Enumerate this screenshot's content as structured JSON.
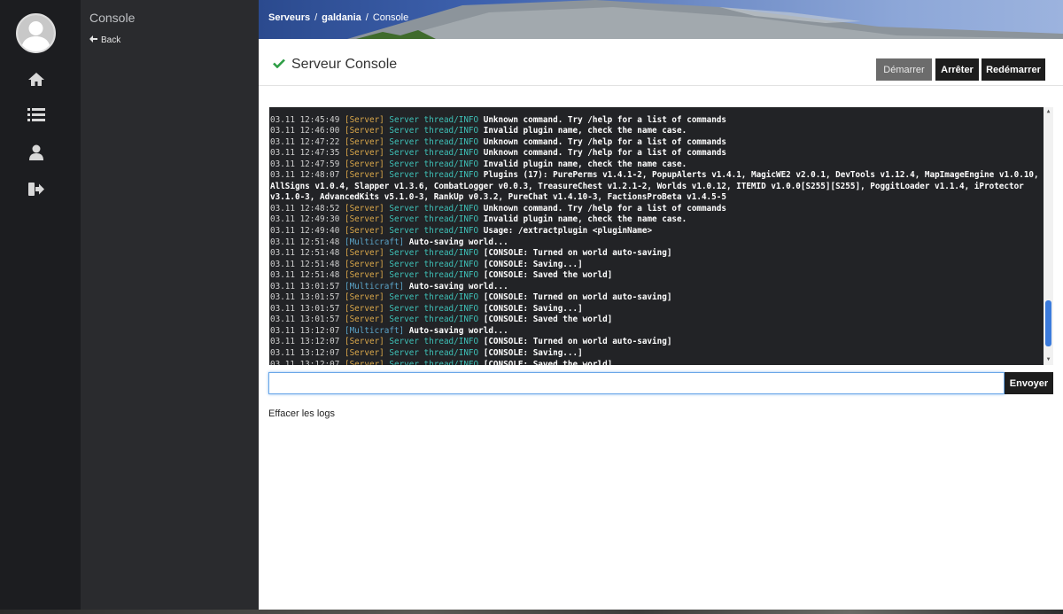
{
  "sidebar": {
    "icons": [
      "home-icon",
      "list-icon",
      "user-icon",
      "sign-out-icon"
    ]
  },
  "submenu": {
    "title": "Console",
    "back_label": "Back"
  },
  "breadcrumb": {
    "items": [
      "Serveurs",
      "galdania",
      "Console"
    ],
    "separator": "/"
  },
  "page": {
    "title": "Serveur Console",
    "status_icon": "check-icon",
    "status_color": "#2e9e45"
  },
  "buttons": {
    "start": "Démarrer",
    "stop": "Arrêter",
    "restart": "Redémarrer",
    "send": "Envoyer",
    "clear_logs": "Effacer les logs"
  },
  "command_input": {
    "value": "",
    "placeholder": ""
  },
  "colors": {
    "console_bg": "#222326",
    "server_tag": "#d9a74a",
    "multicraft_tag": "#5ba3c7",
    "thread": "#3ec0b7",
    "scroll_thumb": "#3b7bdc"
  },
  "console_lines": [
    {
      "ts": "",
      "src": "",
      "thread": "",
      "msg": ""
    },
    {
      "ts": "03.11 12:45:49",
      "src": "[Server]",
      "thread": "Server thread/INFO",
      "msg": "Unknown command. Try /help for a list of commands"
    },
    {
      "ts": "03.11 12:46:00",
      "src": "[Server]",
      "thread": "Server thread/INFO",
      "msg": "Invalid plugin name, check the name case."
    },
    {
      "ts": "03.11 12:47:22",
      "src": "[Server]",
      "thread": "Server thread/INFO",
      "msg": "Unknown command. Try /help for a list of commands"
    },
    {
      "ts": "03.11 12:47:35",
      "src": "[Server]",
      "thread": "Server thread/INFO",
      "msg": "Unknown command. Try /help for a list of commands"
    },
    {
      "ts": "03.11 12:47:59",
      "src": "[Server]",
      "thread": "Server thread/INFO",
      "msg": "Invalid plugin name, check the name case."
    },
    {
      "ts": "03.11 12:48:07",
      "src": "[Server]",
      "thread": "Server thread/INFO",
      "msg": "Plugins (17): PurePerms v1.4.1-2, PopupAlerts v1.4.1, MagicWE2 v2.0.1, DevTools v1.12.4, MapImageEngine v1.0.10, AllSigns v1.0.4, Slapper v1.3.6, CombatLogger v0.0.3, TreasureChest v1.2.1-2, Worlds v1.0.12, ITEMID v1.0.0[S255][S255], PoggitLoader v1.1.4, iProtector v3.1.0-3, AdvancedKits v5.1.0-3, RankUp v0.3.2, PureChat v1.4.10-3, FactionsProBeta v1.4.5-5"
    },
    {
      "ts": "03.11 12:48:52",
      "src": "[Server]",
      "thread": "Server thread/INFO",
      "msg": "Unknown command. Try /help for a list of commands"
    },
    {
      "ts": "03.11 12:49:30",
      "src": "[Server]",
      "thread": "Server thread/INFO",
      "msg": "Invalid plugin name, check the name case."
    },
    {
      "ts": "03.11 12:49:40",
      "src": "[Server]",
      "thread": "Server thread/INFO",
      "msg": "Usage: /extractplugin <pluginName>"
    },
    {
      "ts": "03.11 12:51:48",
      "src": "[Multicraft]",
      "thread": "",
      "msg": "Auto-saving world..."
    },
    {
      "ts": "03.11 12:51:48",
      "src": "[Server]",
      "thread": "Server thread/INFO",
      "msg": "[CONSOLE: Turned on world auto-saving]"
    },
    {
      "ts": "03.11 12:51:48",
      "src": "[Server]",
      "thread": "Server thread/INFO",
      "msg": "[CONSOLE: Saving...]"
    },
    {
      "ts": "03.11 12:51:48",
      "src": "[Server]",
      "thread": "Server thread/INFO",
      "msg": "[CONSOLE: Saved the world]"
    },
    {
      "ts": "03.11 13:01:57",
      "src": "[Multicraft]",
      "thread": "",
      "msg": "Auto-saving world..."
    },
    {
      "ts": "03.11 13:01:57",
      "src": "[Server]",
      "thread": "Server thread/INFO",
      "msg": "[CONSOLE: Turned on world auto-saving]"
    },
    {
      "ts": "03.11 13:01:57",
      "src": "[Server]",
      "thread": "Server thread/INFO",
      "msg": "[CONSOLE: Saving...]"
    },
    {
      "ts": "03.11 13:01:57",
      "src": "[Server]",
      "thread": "Server thread/INFO",
      "msg": "[CONSOLE: Saved the world]"
    },
    {
      "ts": "03.11 13:12:07",
      "src": "[Multicraft]",
      "thread": "",
      "msg": "Auto-saving world..."
    },
    {
      "ts": "03.11 13:12:07",
      "src": "[Server]",
      "thread": "Server thread/INFO",
      "msg": "[CONSOLE: Turned on world auto-saving]"
    },
    {
      "ts": "03.11 13:12:07",
      "src": "[Server]",
      "thread": "Server thread/INFO",
      "msg": "[CONSOLE: Saving...]"
    },
    {
      "ts": "03.11 13:12:07",
      "src": "[Server]",
      "thread": "Server thread/INFO",
      "msg": "[CONSOLE: Saved the world]"
    }
  ]
}
